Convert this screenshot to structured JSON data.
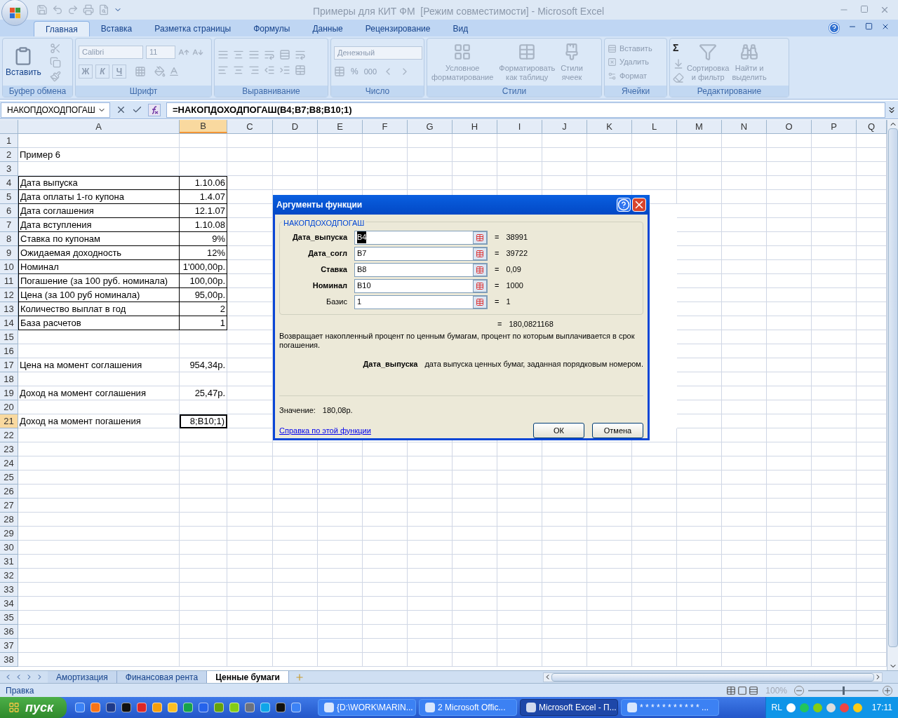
{
  "window": {
    "title": "Примеры для КИТ ФМ  [Режим совместимости] - Microsoft Excel"
  },
  "tabs": [
    {
      "label": "Главная",
      "selected": true
    },
    {
      "label": "Вставка",
      "selected": false
    },
    {
      "label": "Разметка страницы",
      "selected": false
    },
    {
      "label": "Формулы",
      "selected": false
    },
    {
      "label": "Данные",
      "selected": false
    },
    {
      "label": "Рецензирование",
      "selected": false
    },
    {
      "label": "Вид",
      "selected": false
    }
  ],
  "ribbon": {
    "clipboard": {
      "label": "Буфер обмена",
      "paste": "Вставить",
      "disabled": false
    },
    "font": {
      "label": "Шрифт",
      "font": "Calibri",
      "size": "11",
      "styles": [
        "Ж",
        "К",
        "Ч"
      ],
      "disabled": true
    },
    "alignment": {
      "label": "Выравнивание",
      "disabled": true
    },
    "number": {
      "label": "Число",
      "format": "Денежный",
      "percent": "%",
      "thousands": "000",
      "disabled": true
    },
    "styles": {
      "label": "Стили",
      "buttons": [
        "Условное\nформатирование",
        "Форматировать\nкак таблицу",
        "Стили\nячеек"
      ],
      "disabled": true
    },
    "cells": {
      "label": "Ячейки",
      "buttons": [
        "Вставить",
        "Удалить",
        "Формат"
      ],
      "disabled": true
    },
    "editing": {
      "label": "Редактирование",
      "sum": "Σ",
      "buttons": [
        "Сортировка\nи фильтр",
        "Найти и\nвыделить"
      ],
      "disabled": true
    }
  },
  "formula_bar": {
    "name_box": "НАКОПДОХОДПОГАШ",
    "formula": "=НАКОПДОХОДПОГАШ(B4;B7;B8;B10;1)"
  },
  "columns": [
    {
      "label": "A",
      "selected": false
    },
    {
      "label": "B",
      "selected": true
    },
    {
      "label": "C",
      "selected": false
    },
    {
      "label": "D",
      "selected": false
    },
    {
      "label": "E",
      "selected": false
    },
    {
      "label": "F",
      "selected": false
    },
    {
      "label": "G",
      "selected": false
    },
    {
      "label": "H",
      "selected": false
    },
    {
      "label": "I",
      "selected": false
    },
    {
      "label": "J",
      "selected": false
    },
    {
      "label": "K",
      "selected": false
    },
    {
      "label": "L",
      "selected": false
    },
    {
      "label": "M",
      "selected": false
    },
    {
      "label": "N",
      "selected": false
    },
    {
      "label": "O",
      "selected": false
    },
    {
      "label": "P",
      "selected": false
    },
    {
      "label": "Q",
      "selected": false
    }
  ],
  "rows": [
    {
      "num": "1",
      "selected": false,
      "bordered": false
    },
    {
      "num": "2",
      "a": "Пример 6",
      "selected": false,
      "bordered": false
    },
    {
      "num": "3",
      "selected": false,
      "bordered": false
    },
    {
      "num": "4",
      "a": "Дата выпуска",
      "b": "1.10.06",
      "selected": false,
      "bordered": true
    },
    {
      "num": "5",
      "a": "Дата оплаты 1-го купона",
      "b": "1.4.07",
      "selected": false,
      "bordered": true
    },
    {
      "num": "6",
      "a": "Дата соглашения",
      "b": "12.1.07",
      "selected": false,
      "bordered": true
    },
    {
      "num": "7",
      "a": "Дата вступления",
      "b": "1.10.08",
      "selected": false,
      "bordered": true
    },
    {
      "num": "8",
      "a": "Ставка по купонам",
      "b": "9%",
      "selected": false,
      "bordered": true
    },
    {
      "num": "9",
      "a": "Ожидаемая доходность",
      "b": "12%",
      "selected": false,
      "bordered": true
    },
    {
      "num": "10",
      "a": "Номинал",
      "b": "1'000,00р.",
      "selected": false,
      "bordered": true
    },
    {
      "num": "11",
      "a": "Погашение (за 100 руб. номинала)",
      "b": "100,00р.",
      "selected": false,
      "bordered": true
    },
    {
      "num": "12",
      "a": "Цена (за 100 руб номинала)",
      "b": "95,00р.",
      "selected": false,
      "bordered": true
    },
    {
      "num": "13",
      "a": "Количество выплат в год",
      "b": "2",
      "selected": false,
      "bordered": true
    },
    {
      "num": "14",
      "a": "База расчетов",
      "b": "1",
      "selected": false,
      "bordered": true
    },
    {
      "num": "15",
      "selected": false,
      "bordered": false
    },
    {
      "num": "16",
      "selected": false,
      "bordered": false
    },
    {
      "num": "17",
      "a": "Цена на момент соглашения",
      "b": "954,34р.",
      "selected": false,
      "bordered": false
    },
    {
      "num": "18",
      "selected": false,
      "bordered": false
    },
    {
      "num": "19",
      "a": "Доход на момент соглашения",
      "b": "25,47р.",
      "selected": false,
      "bordered": false
    },
    {
      "num": "20",
      "selected": false,
      "bordered": false
    },
    {
      "num": "21",
      "a": "Доход на момент погашения",
      "b": "8;B10;1)",
      "selected": true,
      "bordered": false
    },
    {
      "num": "22",
      "selected": false,
      "bordered": false
    },
    {
      "num": "23",
      "selected": false,
      "bordered": false
    },
    {
      "num": "24",
      "selected": false,
      "bordered": false
    },
    {
      "num": "25",
      "selected": false,
      "bordered": false
    },
    {
      "num": "26",
      "selected": false,
      "bordered": false
    },
    {
      "num": "27",
      "selected": false,
      "bordered": false
    },
    {
      "num": "28",
      "selected": false,
      "bordered": false
    },
    {
      "num": "29",
      "selected": false,
      "bordered": false
    },
    {
      "num": "30",
      "selected": false,
      "bordered": false
    },
    {
      "num": "31",
      "selected": false,
      "bordered": false
    },
    {
      "num": "32",
      "selected": false,
      "bordered": false
    },
    {
      "num": "33",
      "selected": false,
      "bordered": false
    },
    {
      "num": "34",
      "selected": false,
      "bordered": false
    },
    {
      "num": "35",
      "selected": false,
      "bordered": false
    },
    {
      "num": "36",
      "selected": false,
      "bordered": false
    },
    {
      "num": "37",
      "selected": false,
      "bordered": false
    },
    {
      "num": "38",
      "selected": false,
      "bordered": false
    }
  ],
  "sheet_tabs": [
    {
      "label": "Амортизация",
      "selected": false
    },
    {
      "label": "Финансовая рента",
      "selected": false
    },
    {
      "label": "Ценные бумаги",
      "selected": true
    }
  ],
  "status_bar": {
    "mode": "Правка",
    "zoom": "100%",
    "level": 0.5
  },
  "dialog": {
    "title": "Аргументы функции",
    "function": "НАКОПДОХОДПОГАШ",
    "args": [
      {
        "name": "Дата_выпуска",
        "value": "B4",
        "result": "38991",
        "required": true,
        "focused": true
      },
      {
        "name": "Дата_согл",
        "value": "B7",
        "result": "39722",
        "required": true,
        "focused": false
      },
      {
        "name": "Ставка",
        "value": "B8",
        "result": "0,09",
        "required": true,
        "focused": false
      },
      {
        "name": "Номинал",
        "value": "B10",
        "result": "1000",
        "required": true,
        "focused": false
      },
      {
        "name": "Базис",
        "value": "1",
        "result": "1",
        "required": false,
        "focused": false
      }
    ],
    "equals": "=",
    "total": "180,0821168",
    "description": "Возвращает накопленный процент по ценным бумагам, процент по которым выплачивается в срок погашения.",
    "arg_help_name": "Дата_выпуска",
    "arg_help": "дата выпуска ценных бумаг, заданная порядковым номером.",
    "value_label": "Значение:",
    "value": "180,08р.",
    "help_link": "Справка по этой функции",
    "ok": "ОК",
    "cancel": "Отмена"
  },
  "taskbar": {
    "start": "пуск",
    "tasks": [
      {
        "label": "{D:\\WORK\\MARIN...",
        "selected": false
      },
      {
        "label": "2 Microsoft Offic...",
        "selected": false
      },
      {
        "label": "Microsoft Excel - П...",
        "selected": true
      },
      {
        "label": "* * * * * * * * * * * ...",
        "selected": false
      }
    ],
    "language": "RL",
    "time": "17:11"
  }
}
